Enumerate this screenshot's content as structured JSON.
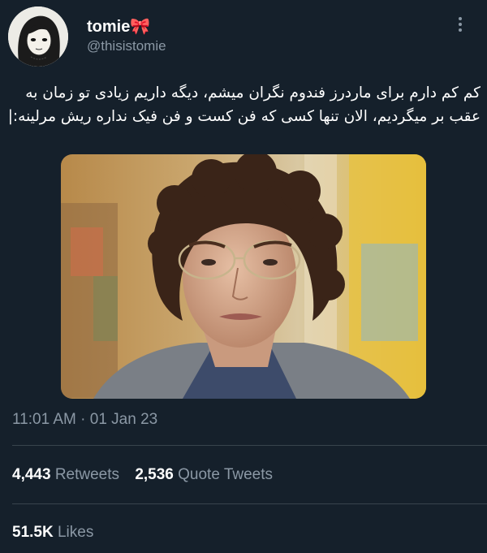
{
  "author": {
    "name": "tomie",
    "name_emoji": "🎀",
    "handle": "@thisistomie"
  },
  "tweet": {
    "text_line1": "کم کم دارم برای ماردرز فندوم نگران میشم، دیگه داریم زیادی تو زمان به",
    "text_line2": "عقب بر میگردیم، الان تنها کسی که فن کست و فن فیک نداره ریش مرلینه:|"
  },
  "icons": {
    "more": "more-options-icon"
  },
  "meta": {
    "time": "11:01 AM",
    "separator": "·",
    "date": "01 Jan 23"
  },
  "stats": {
    "retweets_count": "4,443",
    "retweets_label": "Retweets",
    "quotes_count": "2,536",
    "quotes_label": "Quote Tweets",
    "likes_count": "51.5K",
    "likes_label": "Likes"
  },
  "colors": {
    "background": "#15202b",
    "text_primary": "#ffffff",
    "text_secondary": "#8b98a5",
    "divider": "#38444d"
  }
}
